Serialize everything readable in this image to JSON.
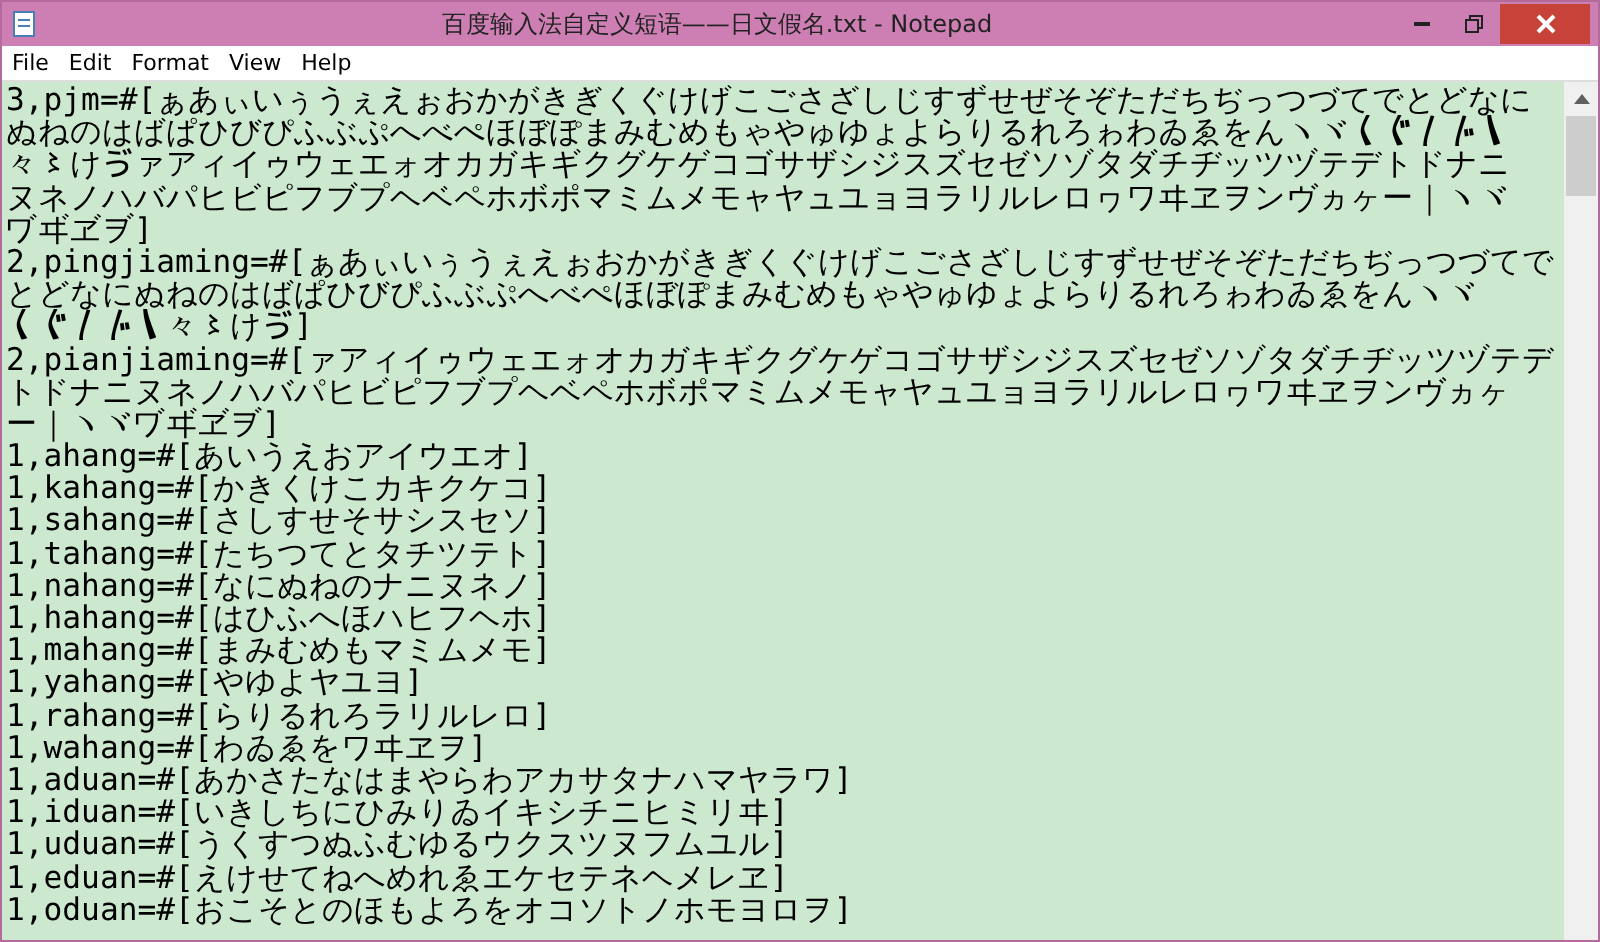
{
  "window": {
    "title": "百度输入法自定义短语——日文假名.txt - Notepad"
  },
  "menu": [
    "File",
    "Edit",
    "Format",
    "View",
    "Help"
  ],
  "editor": {
    "lines": [
      "3,pjm=#[ぁあぃいぅうぇえぉおかがきぎくぐけげこごさざしじすずせぜそぞただちぢっつづてでとどなに",
      "ぬねのはばぱひびぴふぶぷへべぺほぼぽまみむめもゃやゅゆょよらりるれろゎわゐゑをんヽヾ〱〲〳〴〵",
      "々〻けゔァアィイゥウェエォオカガキギクグケゲコゴサザシジスズセゼソゾタダチヂッツヅテデトドナニ",
      "ヌネノハバパヒビピフブプヘベペホボポマミムメモャヤュユョヨラリルレロヮワヰヱヲンヴヵヶー｜ヽヾ",
      "ヷヸヹヺ]",
      "2,pingjiaming=#[ぁあぃいぅうぇえぉおかがきぎくぐけげこごさざしじすずせぜそぞただちぢっつづてで",
      "とどなにぬねのはばぱひびぴふぶぷへべぺほぼぽまみむめもゃやゅゆょよらりるれろゎわゐゑをんヽヾ",
      "〱〲〳〴〵々〻けゔ]",
      "2,pianjiaming=#[ァアィイゥウェエォオカガキギクグケゲコゴサザシジスズセゼソゾタダチヂッツヅテデ",
      "トドナニヌネノハバパヒビピフブプヘベペホボポマミムメモャヤュユョヨラリルレロヮワヰヱヲンヴヵヶ",
      "ー｜ヽヾヷヸヹヺ]",
      "1,ahang=#[あいうえおアイウエオ]",
      "1,kahang=#[かきくけこカキクケコ]",
      "1,sahang=#[さしすせそサシスセソ]",
      "1,tahang=#[たちつてとタチツテト]",
      "1,nahang=#[なにぬねのナニヌネノ]",
      "1,hahang=#[はひふへほハヒフヘホ]",
      "1,mahang=#[まみむめもマミムメモ]",
      "1,yahang=#[やゆよヤユヨ]",
      "1,rahang=#[らりるれろラリルレロ]",
      "1,wahang=#[わゐゑをワヰヱヲ]",
      "1,aduan=#[あかさたなはまやらわアカサタナハマヤラワ]",
      "1,iduan=#[いきしちにひみりゐイキシチニヒミリヰ]",
      "1,uduan=#[うくすつぬふむゆるウクスツヌフムユル]",
      "1,eduan=#[えけせてねへめれゑエケセテネヘメレヱ]",
      "1,oduan=#[おこそとのほもよろをオコソトノホモヨロヲ]"
    ]
  }
}
